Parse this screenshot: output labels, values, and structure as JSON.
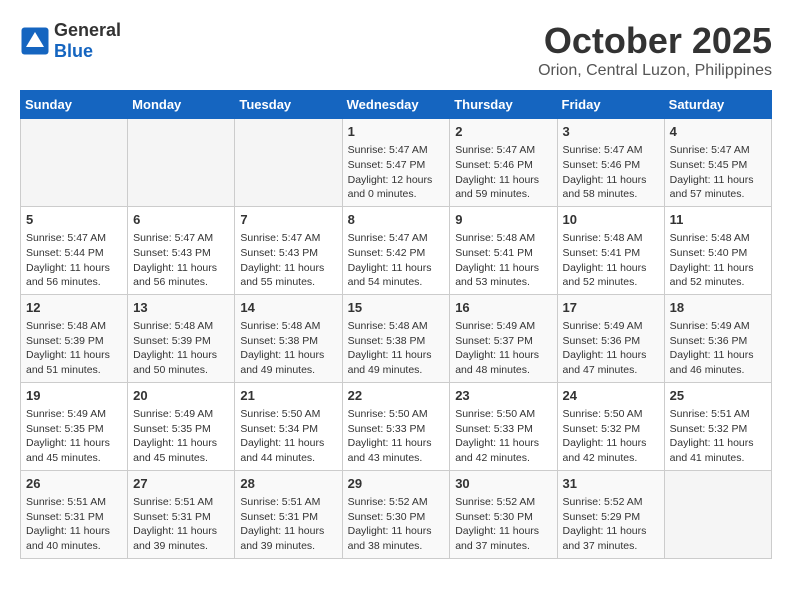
{
  "header": {
    "logo_general": "General",
    "logo_blue": "Blue",
    "month": "October 2025",
    "location": "Orion, Central Luzon, Philippines"
  },
  "weekdays": [
    "Sunday",
    "Monday",
    "Tuesday",
    "Wednesday",
    "Thursday",
    "Friday",
    "Saturday"
  ],
  "weeks": [
    [
      {
        "day": "",
        "info": ""
      },
      {
        "day": "",
        "info": ""
      },
      {
        "day": "",
        "info": ""
      },
      {
        "day": "1",
        "info": "Sunrise: 5:47 AM\nSunset: 5:47 PM\nDaylight: 12 hours and 0 minutes."
      },
      {
        "day": "2",
        "info": "Sunrise: 5:47 AM\nSunset: 5:46 PM\nDaylight: 11 hours and 59 minutes."
      },
      {
        "day": "3",
        "info": "Sunrise: 5:47 AM\nSunset: 5:46 PM\nDaylight: 11 hours and 58 minutes."
      },
      {
        "day": "4",
        "info": "Sunrise: 5:47 AM\nSunset: 5:45 PM\nDaylight: 11 hours and 57 minutes."
      }
    ],
    [
      {
        "day": "5",
        "info": "Sunrise: 5:47 AM\nSunset: 5:44 PM\nDaylight: 11 hours and 56 minutes."
      },
      {
        "day": "6",
        "info": "Sunrise: 5:47 AM\nSunset: 5:43 PM\nDaylight: 11 hours and 56 minutes."
      },
      {
        "day": "7",
        "info": "Sunrise: 5:47 AM\nSunset: 5:43 PM\nDaylight: 11 hours and 55 minutes."
      },
      {
        "day": "8",
        "info": "Sunrise: 5:47 AM\nSunset: 5:42 PM\nDaylight: 11 hours and 54 minutes."
      },
      {
        "day": "9",
        "info": "Sunrise: 5:48 AM\nSunset: 5:41 PM\nDaylight: 11 hours and 53 minutes."
      },
      {
        "day": "10",
        "info": "Sunrise: 5:48 AM\nSunset: 5:41 PM\nDaylight: 11 hours and 52 minutes."
      },
      {
        "day": "11",
        "info": "Sunrise: 5:48 AM\nSunset: 5:40 PM\nDaylight: 11 hours and 52 minutes."
      }
    ],
    [
      {
        "day": "12",
        "info": "Sunrise: 5:48 AM\nSunset: 5:39 PM\nDaylight: 11 hours and 51 minutes."
      },
      {
        "day": "13",
        "info": "Sunrise: 5:48 AM\nSunset: 5:39 PM\nDaylight: 11 hours and 50 minutes."
      },
      {
        "day": "14",
        "info": "Sunrise: 5:48 AM\nSunset: 5:38 PM\nDaylight: 11 hours and 49 minutes."
      },
      {
        "day": "15",
        "info": "Sunrise: 5:48 AM\nSunset: 5:38 PM\nDaylight: 11 hours and 49 minutes."
      },
      {
        "day": "16",
        "info": "Sunrise: 5:49 AM\nSunset: 5:37 PM\nDaylight: 11 hours and 48 minutes."
      },
      {
        "day": "17",
        "info": "Sunrise: 5:49 AM\nSunset: 5:36 PM\nDaylight: 11 hours and 47 minutes."
      },
      {
        "day": "18",
        "info": "Sunrise: 5:49 AM\nSunset: 5:36 PM\nDaylight: 11 hours and 46 minutes."
      }
    ],
    [
      {
        "day": "19",
        "info": "Sunrise: 5:49 AM\nSunset: 5:35 PM\nDaylight: 11 hours and 45 minutes."
      },
      {
        "day": "20",
        "info": "Sunrise: 5:49 AM\nSunset: 5:35 PM\nDaylight: 11 hours and 45 minutes."
      },
      {
        "day": "21",
        "info": "Sunrise: 5:50 AM\nSunset: 5:34 PM\nDaylight: 11 hours and 44 minutes."
      },
      {
        "day": "22",
        "info": "Sunrise: 5:50 AM\nSunset: 5:33 PM\nDaylight: 11 hours and 43 minutes."
      },
      {
        "day": "23",
        "info": "Sunrise: 5:50 AM\nSunset: 5:33 PM\nDaylight: 11 hours and 42 minutes."
      },
      {
        "day": "24",
        "info": "Sunrise: 5:50 AM\nSunset: 5:32 PM\nDaylight: 11 hours and 42 minutes."
      },
      {
        "day": "25",
        "info": "Sunrise: 5:51 AM\nSunset: 5:32 PM\nDaylight: 11 hours and 41 minutes."
      }
    ],
    [
      {
        "day": "26",
        "info": "Sunrise: 5:51 AM\nSunset: 5:31 PM\nDaylight: 11 hours and 40 minutes."
      },
      {
        "day": "27",
        "info": "Sunrise: 5:51 AM\nSunset: 5:31 PM\nDaylight: 11 hours and 39 minutes."
      },
      {
        "day": "28",
        "info": "Sunrise: 5:51 AM\nSunset: 5:31 PM\nDaylight: 11 hours and 39 minutes."
      },
      {
        "day": "29",
        "info": "Sunrise: 5:52 AM\nSunset: 5:30 PM\nDaylight: 11 hours and 38 minutes."
      },
      {
        "day": "30",
        "info": "Sunrise: 5:52 AM\nSunset: 5:30 PM\nDaylight: 11 hours and 37 minutes."
      },
      {
        "day": "31",
        "info": "Sunrise: 5:52 AM\nSunset: 5:29 PM\nDaylight: 11 hours and 37 minutes."
      },
      {
        "day": "",
        "info": ""
      }
    ]
  ]
}
